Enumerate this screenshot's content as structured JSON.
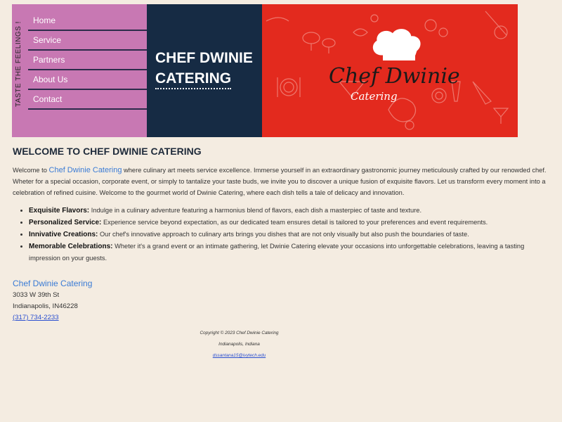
{
  "tagline": "TASTE THE FEELINGS !",
  "nav": {
    "items": [
      {
        "label": "Home"
      },
      {
        "label": "Service"
      },
      {
        "label": "Partners"
      },
      {
        "label": "About Us"
      },
      {
        "label": "Contact"
      }
    ]
  },
  "header": {
    "title_line1": "CHEF DWINIE",
    "title_line2": "CATERING"
  },
  "banner": {
    "logo_script": "Chef Dwinie",
    "logo_sub": "Catering",
    "background_color": "#e32a1e"
  },
  "main": {
    "heading": "WELCOME TO CHEF DWINIE CATERING",
    "intro_prefix": "Welcome to",
    "intro_link": "Chef Dwinie Catering",
    "intro_rest": "where culinary art meets service excellence. Immerse yourself in an extraordinary gastronomic journey meticulously crafted by our renowded chef. Wheter for a special occasion, corporate event, or simply to tantalize your taste buds, we invite you to discover a unique fusion of exquisite flavors. Let us transform every moment into a celebration of refined cuisine. Welcome to the gourmet world of Dwinie Catering, where each dish tells a tale of delicacy and innovation.",
    "features": [
      {
        "title": "Exquisite Flavors:",
        "text": "Indulge in a culinary adventure featuring a harmonius blend of flavors, each dish a masterpiec of taste and texture."
      },
      {
        "title": "Personalized Service:",
        "text": "Experience service beyond expectation, as our dedicated team ensures detail is tailored to your preferences and event requirements."
      },
      {
        "title": "Innivative Creations:",
        "text": "Our chef's innovative approach to culinary arts brings you dishes that are not only visually but also push the boundaries of taste."
      },
      {
        "title": "Memorable Celebrations:",
        "text": "Wheter it's a grand event or an intimate gathering, let Dwinie Catering elevate your occasions into unforgettable celebrations, leaving a tasting impression on your guests."
      }
    ]
  },
  "contact": {
    "company": "Chef Dwinie Catering",
    "street": "3033 W 39th St",
    "city": "Indianapolis, IN46228",
    "phone": "(317) 734-2233"
  },
  "footer": {
    "copyright": "Copyright © 2023 Chef Dwinie Catering",
    "location": "Indianapolis, Indiana",
    "email": "dssantana15@ivytech.edu"
  }
}
